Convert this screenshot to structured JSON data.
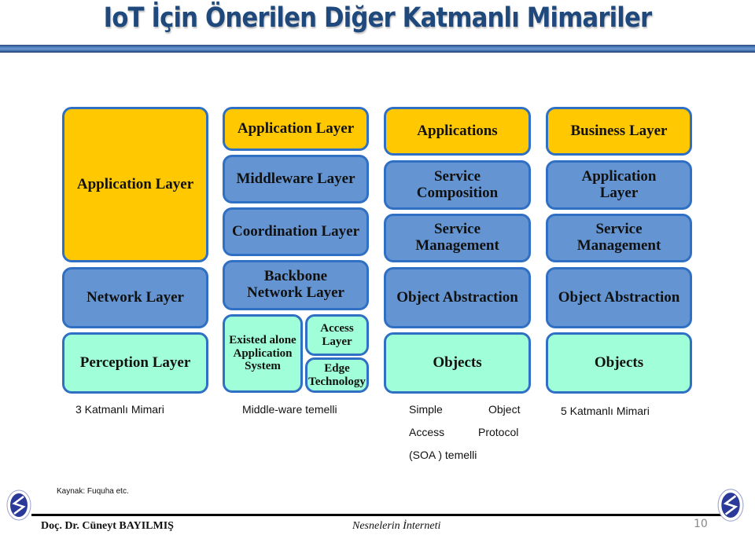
{
  "title": "IoT İçin Önerilen Diğer Katmanlı Mimariler",
  "colors": {
    "title": "#1f497d",
    "yellow_layer": "#ffc800",
    "blue_layer": "#6495d2",
    "green_layer": "#a0ffd8",
    "border": "#2f6fc4"
  },
  "architectures": [
    {
      "caption": "3 Katmanlı Mimari",
      "layers": [
        "Application Layer",
        "Network Layer",
        "Perception Layer"
      ]
    },
    {
      "caption": "Middle-ware temelli",
      "layers": [
        "Application Layer",
        "Middleware Layer",
        "Coordination Layer",
        "Backbone Network Layer"
      ],
      "bottom": {
        "left": "Existed alone Application System",
        "right_top": "Access Layer",
        "right_bottom": "Edge Technology"
      }
    },
    {
      "caption_lines": [
        "Simple",
        "Object",
        "Access",
        "Protocol",
        "(SOA ) temelli"
      ],
      "layers": [
        "Applications",
        "Service Composition",
        "Service Management",
        "Object Abstraction",
        "Objects"
      ]
    },
    {
      "caption": "5 Katmanlı Mimari",
      "layers": [
        "Business Layer",
        "Application Layer",
        "Service Management",
        "Object Abstraction",
        "Objects"
      ]
    }
  ],
  "footer": {
    "source": "Kaynak: Fuquha etc.",
    "author": "Doç. Dr. Cüneyt BAYILMIŞ",
    "course": "Nesnelerin İnterneti",
    "page": "10",
    "logo_icon": "university-logo-icon"
  }
}
